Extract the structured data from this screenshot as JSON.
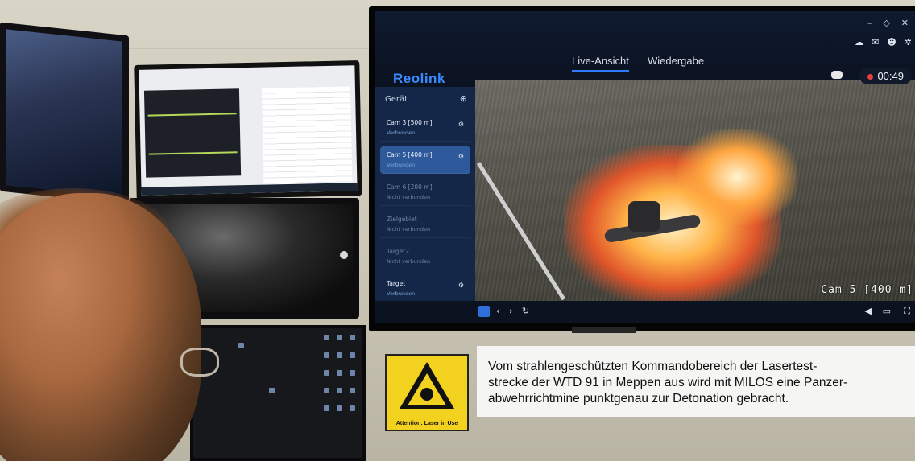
{
  "tv": {
    "app_logo": "Reolink",
    "tabs": [
      {
        "label": "Live-Ansicht",
        "active": true
      },
      {
        "label": "Wiedergabe",
        "active": false
      }
    ],
    "sidebar_title": "Gerät",
    "cameras": [
      {
        "name": "Cam 3 [500 m]",
        "status": "Verbunden",
        "state": "online"
      },
      {
        "name": "Cam 5 [400 m]",
        "status": "Verbunden",
        "state": "selected"
      },
      {
        "name": "Cam 6 [200 m]",
        "status": "Nicht verbunden",
        "state": "offline"
      },
      {
        "name": "Zielgebiet",
        "status": "Nicht verbunden",
        "state": "offline"
      },
      {
        "name": "Target2",
        "status": "Nicht verbunden",
        "state": "offline"
      },
      {
        "name": "Target",
        "status": "Verbunden",
        "state": "online"
      }
    ],
    "record_timer": "00:49",
    "video_overlay": "Cam 5 [400 m]"
  },
  "sign": {
    "text": "Attention: Laser in Use"
  },
  "caption": {
    "lines": [
      "Vom strahlengeschützten Kommandobereich der Lasertest-",
      "strecke der WTD 91 in Meppen aus wird mit MILOS eine Panzer-",
      "abwehrrichtmine punktgenau zur Detonation gebracht."
    ]
  }
}
